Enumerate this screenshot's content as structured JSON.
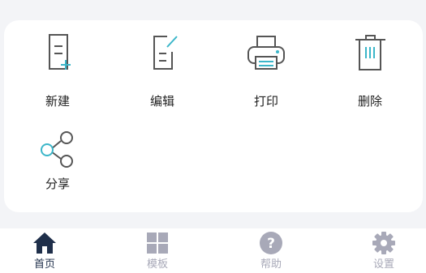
{
  "actions": [
    {
      "label": "新建",
      "icon": "new-document-icon"
    },
    {
      "label": "编辑",
      "icon": "edit-document-icon"
    },
    {
      "label": "打印",
      "icon": "printer-icon"
    },
    {
      "label": "删除",
      "icon": "trash-icon"
    },
    {
      "label": "分享",
      "icon": "share-icon"
    }
  ],
  "tabs": [
    {
      "label": "首页",
      "icon": "home-icon",
      "active": true
    },
    {
      "label": "模板",
      "icon": "grid-icon",
      "active": false
    },
    {
      "label": "帮助",
      "icon": "help-icon",
      "active": false
    },
    {
      "label": "设置",
      "icon": "gear-icon",
      "active": false
    }
  ],
  "colors": {
    "background": "#f3f4f7",
    "card": "#ffffff",
    "icon_stroke": "#555555",
    "accent": "#3bb6c9",
    "active_tab": "#1f2f4a",
    "inactive_tab": "#a8a9b8"
  }
}
